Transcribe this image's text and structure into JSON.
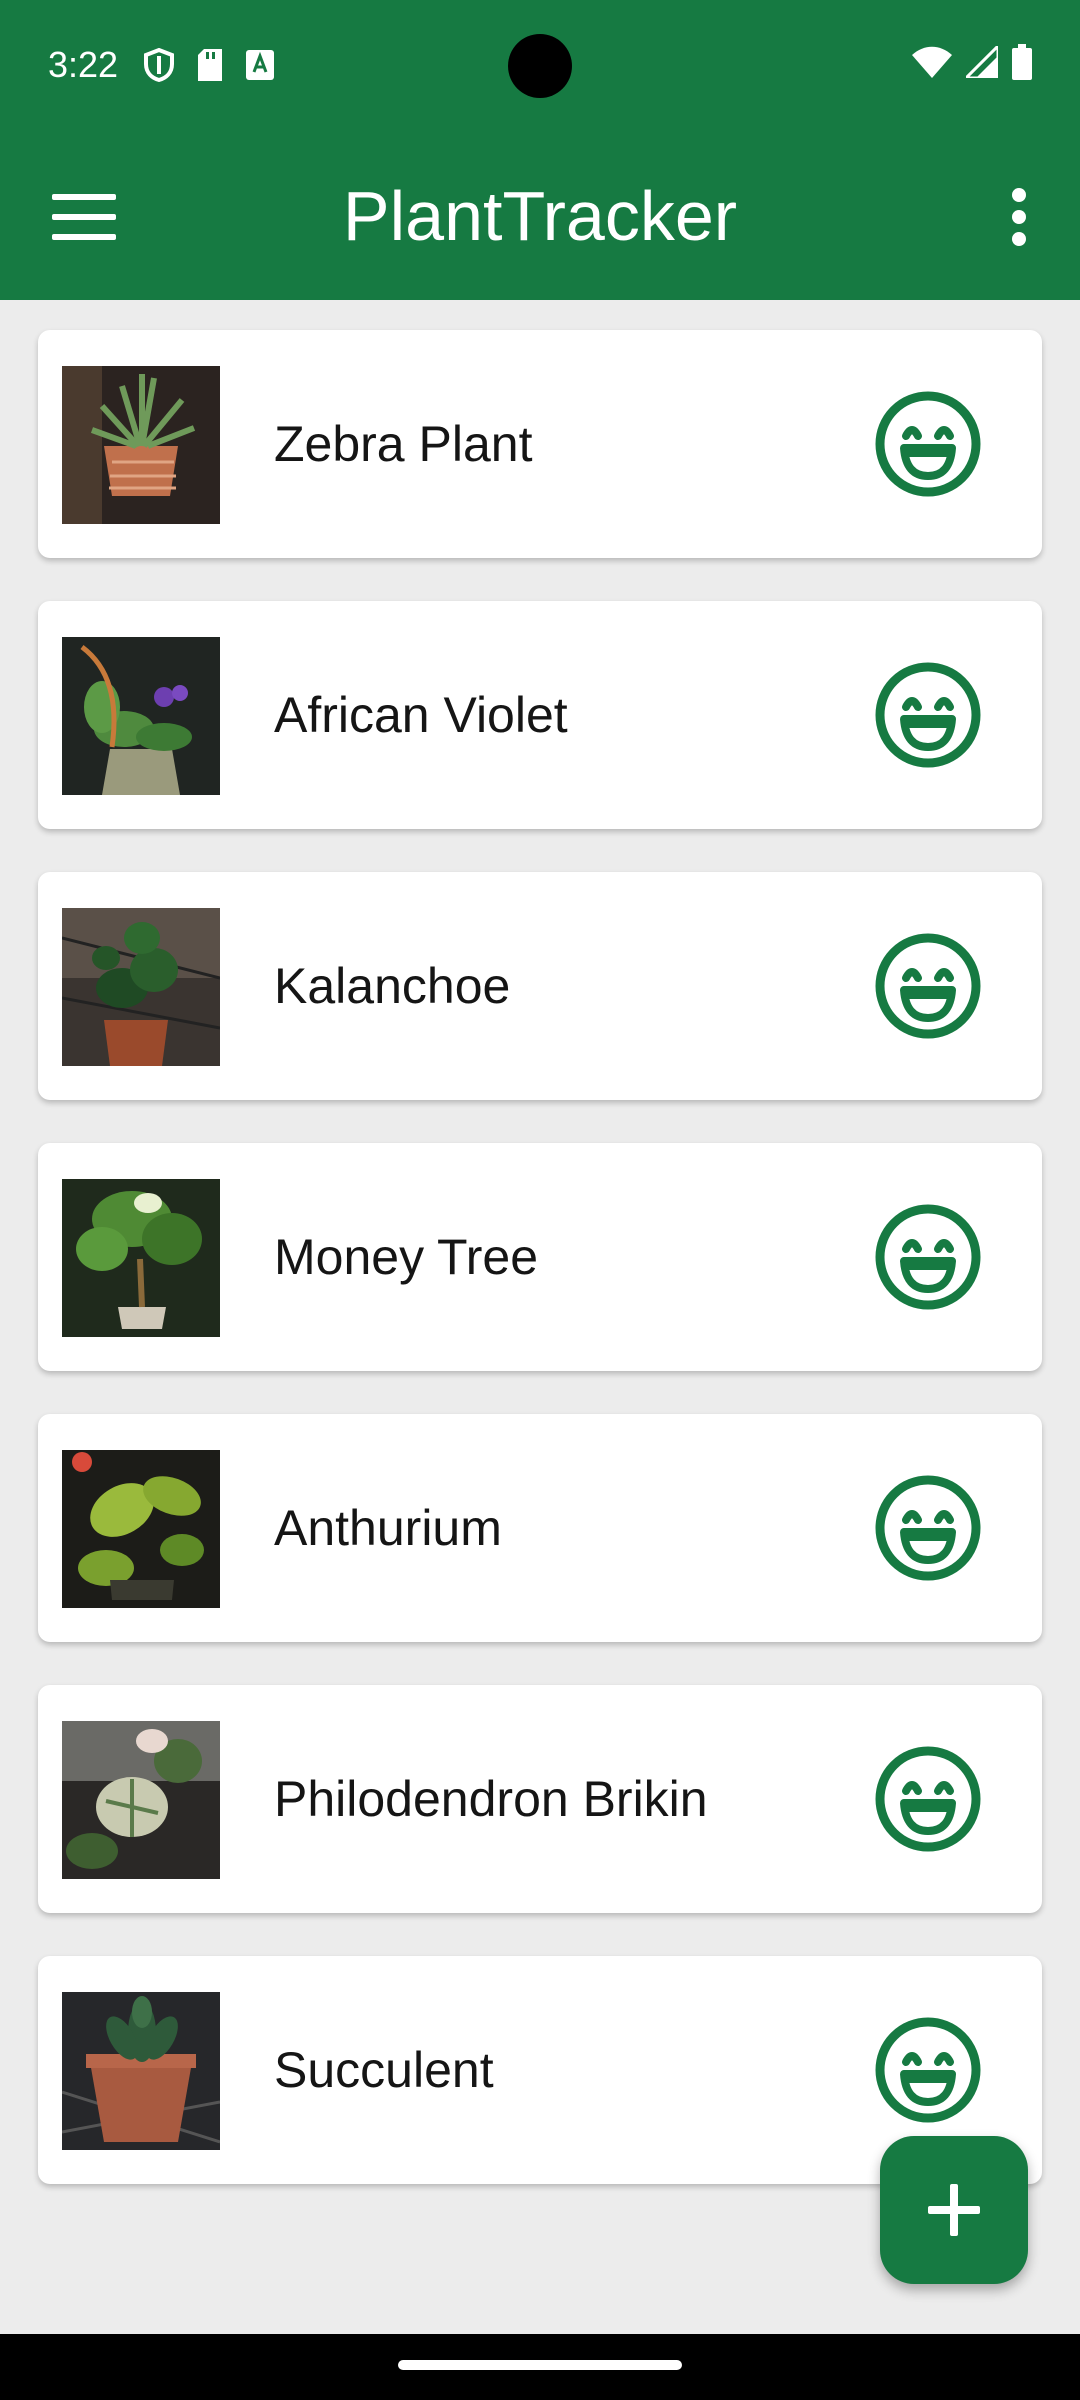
{
  "status_bar": {
    "time": "3:22",
    "left_icons": [
      "shield-icon",
      "sd-card-icon",
      "keyboard-a-icon"
    ],
    "right_icons": [
      "wifi-icon",
      "signal-icon",
      "battery-icon"
    ]
  },
  "app_bar": {
    "title": "PlantTracker",
    "menu_icon": "hamburger-menu-icon",
    "overflow_icon": "more-vertical-icon"
  },
  "plants": [
    {
      "name": "Zebra Plant",
      "mood": "happy-face-icon"
    },
    {
      "name": "African Violet",
      "mood": "happy-face-icon"
    },
    {
      "name": "Kalanchoe",
      "mood": "happy-face-icon"
    },
    {
      "name": "Money Tree",
      "mood": "happy-face-icon"
    },
    {
      "name": "Anthurium",
      "mood": "happy-face-icon"
    },
    {
      "name": "Philodendron Brikin",
      "mood": "happy-face-icon"
    },
    {
      "name": "Succulent",
      "mood": "happy-face-icon"
    }
  ],
  "fab": {
    "icon": "plus-icon"
  },
  "colors": {
    "primary": "#167a42",
    "background": "#ececec",
    "card": "#ffffff"
  }
}
